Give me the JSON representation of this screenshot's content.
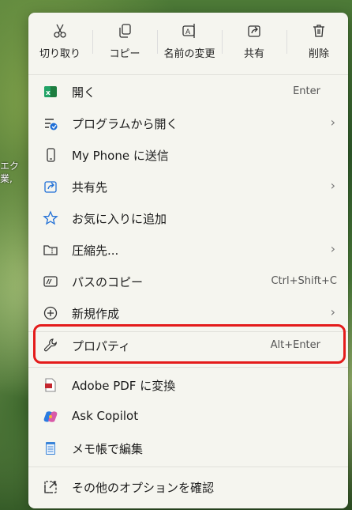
{
  "desktop": {
    "text_line1": "エク",
    "text_line2": "業,"
  },
  "toolbar": {
    "cut": "切り取り",
    "copy": "コピー",
    "rename": "名前の変更",
    "share": "共有",
    "delete": "削除"
  },
  "menu": {
    "items": [
      {
        "label": "開く",
        "shortcut": "Enter",
        "icon": "open-app-icon"
      },
      {
        "label": "プログラムから開く",
        "arrow": "›",
        "icon": "open-with-icon"
      },
      {
        "label": "My Phone に送信",
        "icon": "phone-icon"
      },
      {
        "label": "共有先",
        "arrow": "›",
        "icon": "share-icon"
      },
      {
        "label": "お気に入りに追加",
        "icon": "star-icon"
      },
      {
        "label": "圧縮先...",
        "arrow": "›",
        "icon": "zip-icon"
      },
      {
        "label": "パスのコピー",
        "shortcut": "Ctrl+Shift+C",
        "icon": "path-copy-icon"
      },
      {
        "label": "新規作成",
        "arrow": "›",
        "icon": "new-icon"
      },
      {
        "label": "プロパティ",
        "shortcut": "Alt+Enter",
        "icon": "wrench-icon"
      },
      {
        "label": "Adobe PDF に変換",
        "icon": "adobe-pdf-icon"
      },
      {
        "label": "Ask Copilot",
        "icon": "copilot-icon"
      },
      {
        "label": "メモ帳で編集",
        "icon": "notepad-icon"
      },
      {
        "label": "その他のオプションを確認",
        "icon": "more-options-icon"
      }
    ]
  },
  "colors": {
    "highlight": "#e41b1b",
    "menu_bg": "#f5f5ef"
  }
}
